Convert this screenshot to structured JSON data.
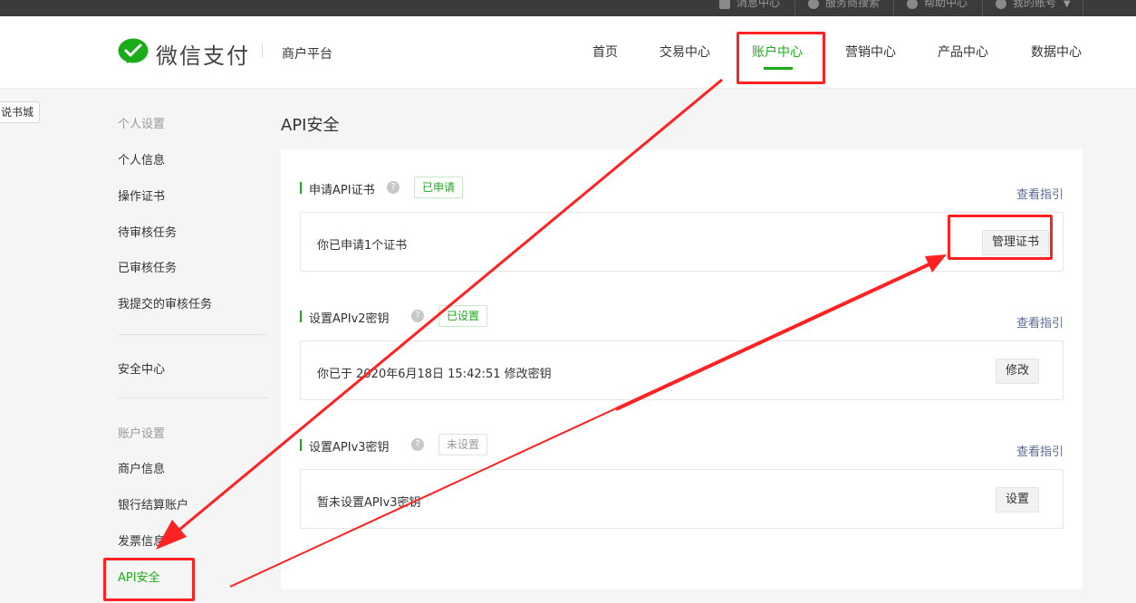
{
  "topbar": {
    "items": [
      {
        "label": "消息中心",
        "icon": "mail-icon"
      },
      {
        "label": "服务商搜索",
        "icon": "service-icon"
      },
      {
        "label": "帮助中心",
        "icon": "help-icon"
      },
      {
        "label": "我的账号",
        "icon": "user-icon"
      }
    ]
  },
  "header": {
    "brand": "微信支付",
    "sub": "商户平台",
    "nav": [
      "首页",
      "交易中心",
      "账户中心",
      "营销中心",
      "产品中心",
      "数据中心"
    ],
    "active_nav": "账户中心"
  },
  "float_tag": "说书城",
  "sidebar": {
    "personal_heading": "个人设置",
    "personal_items": [
      "个人信息",
      "操作证书",
      "待审核任务",
      "已审核任务",
      "我提交的审核任务"
    ],
    "security_item": "安全中心",
    "account_heading": "账户设置",
    "account_items": [
      "商户信息",
      "银行结算账户",
      "发票信息",
      "API安全"
    ],
    "active_item": "API安全"
  },
  "main": {
    "title": "API安全",
    "sections": [
      {
        "title": "申请API证书",
        "status": "已申请",
        "guide": "查看指引",
        "row_text": "你已申请1个证书",
        "button": "管理证书"
      },
      {
        "title": "设置APIv2密钥",
        "status": "已设置",
        "guide": "查看指引",
        "row_text": "你已于 2020年6月18日 15:42:51 修改密钥",
        "button": "修改"
      },
      {
        "title": "设置APIv3密钥",
        "status": "未设置",
        "guide": "查看指引",
        "row_text": "暂未设置APIv3密钥",
        "button": "设置"
      }
    ]
  },
  "colors": {
    "accent_green": "#1aad19",
    "link_blue": "#576b95",
    "annotation_red": "#ff2222"
  }
}
